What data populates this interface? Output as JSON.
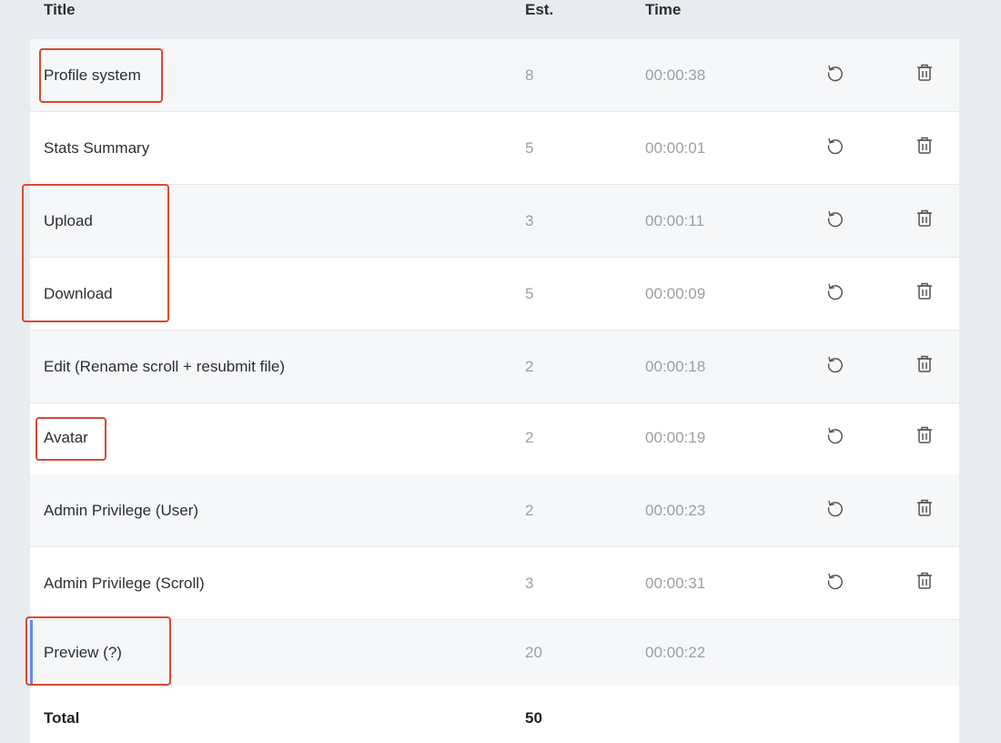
{
  "table": {
    "headers": {
      "title": "Title",
      "est": "Est.",
      "time": "Time"
    },
    "rows": [
      {
        "title": "Profile system",
        "est": "8",
        "time": "00:00:38"
      },
      {
        "title": "Stats Summary",
        "est": "5",
        "time": "00:00:01"
      },
      {
        "title": "Upload",
        "est": "3",
        "time": "00:00:11"
      },
      {
        "title": "Download",
        "est": "5",
        "time": "00:00:09"
      },
      {
        "title": "Edit (Rename scroll + resubmit file)",
        "est": "2",
        "time": "00:00:18"
      },
      {
        "title": "Avatar",
        "est": "2",
        "time": "00:00:19"
      },
      {
        "title": "Admin Privilege (User)",
        "est": "2",
        "time": "00:00:23"
      },
      {
        "title": "Admin Privilege (Scroll)",
        "est": "3",
        "time": "00:00:31"
      },
      {
        "title": "Preview (?)",
        "est": "20",
        "time": "00:00:22"
      }
    ],
    "total": {
      "label": "Total",
      "value": "50"
    }
  },
  "icons": {
    "reset": "reset-icon",
    "delete": "trash-icon"
  },
  "colors": {
    "highlight": "#d94a32",
    "active_bar": "#5b8def",
    "header_bg": "#e8ebf0"
  }
}
